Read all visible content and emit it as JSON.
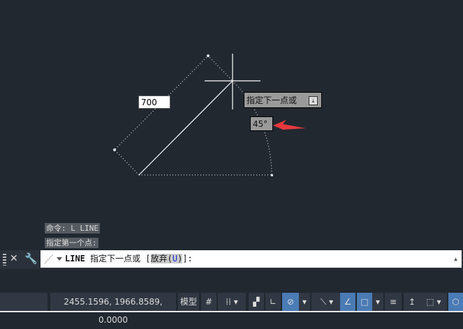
{
  "drawing": {
    "dimension_value": "700",
    "tooltip_prompt": "指定下一点或",
    "tooltip_icon": "download-icon",
    "angle_value": "45°",
    "arrow_color": "#e8383d"
  },
  "command_history": [
    "命令: L LINE",
    "指定第一个点:"
  ],
  "command_line": {
    "command": "LINE",
    "prompt": "指定下一点或 [",
    "option": "放弃(",
    "option_key": "U",
    "suffix": ")]:"
  },
  "status_bar": {
    "coordinates": "2455.1596, 1966.8589, 0.0000",
    "model_label": "模型"
  }
}
